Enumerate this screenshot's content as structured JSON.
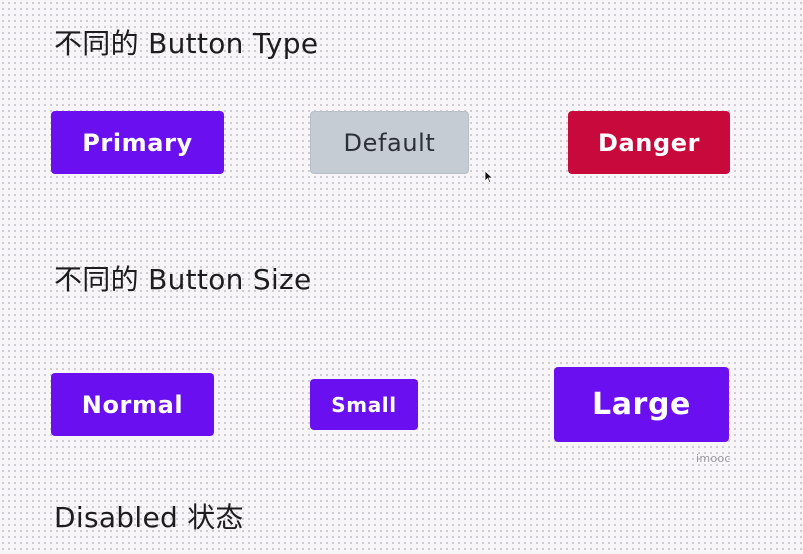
{
  "sections": {
    "type": {
      "title": "不同的 Button Type",
      "buttons": {
        "primary": "Primary",
        "default": "Default",
        "danger": "Danger"
      }
    },
    "size": {
      "title": "不同的 Button Size",
      "buttons": {
        "normal": "Normal",
        "small": "Small",
        "large": "Large"
      }
    },
    "disabled": {
      "title": "Disabled 状态"
    }
  },
  "watermark": "imooc",
  "colors": {
    "primary": "#6a0ff0",
    "default": "#c5ccd4",
    "danger": "#c8093c",
    "text": "#1d1d1f"
  },
  "icons": {
    "cursor": "mouse-pointer-icon"
  }
}
